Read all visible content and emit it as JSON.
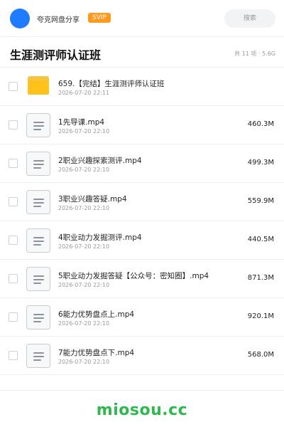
{
  "header": {
    "sharer_name": "夸克网盘分享",
    "badge": "SVIP",
    "search_placeholder": "搜索"
  },
  "folder": {
    "title": "生涯测评师认证班",
    "summary": "共 11 项 · 5.6G"
  },
  "files": [
    {
      "name": "659.【完结】生涯测评师认证班",
      "date": "2026-07-20 22:11",
      "size": "",
      "type": "folder"
    },
    {
      "name": "1先导课.mp4",
      "date": "2026-07-20 22:10",
      "size": "460.3M",
      "type": "file"
    },
    {
      "name": "2职业兴趣探索测评.mp4",
      "date": "2026-07-20 22:10",
      "size": "499.3M",
      "type": "file"
    },
    {
      "name": "3职业兴趣答疑.mp4",
      "date": "2026-07-20 22:10",
      "size": "559.9M",
      "type": "file"
    },
    {
      "name": "4职业动力发掘测评.mp4",
      "date": "2026-07-20 22:10",
      "size": "440.5M",
      "type": "file"
    },
    {
      "name": "5职业动力发掘答疑【公众号：密知圈】.mp4",
      "date": "2026-07-20 22:10",
      "size": "871.3M",
      "type": "file"
    },
    {
      "name": "6能力优势盘点上.mp4",
      "date": "2026-07-20 22:10",
      "size": "920.1M",
      "type": "file"
    },
    {
      "name": "7能力优势盘点下.mp4",
      "date": "2026-07-20 22:10",
      "size": "568.0M",
      "type": "file"
    }
  ],
  "watermark": "miosou.cc",
  "colors": {
    "avatar": "#1f7bff",
    "badge": "#ff9a1f",
    "folder": "#ffc21a",
    "watermark": "#2eb84f"
  }
}
